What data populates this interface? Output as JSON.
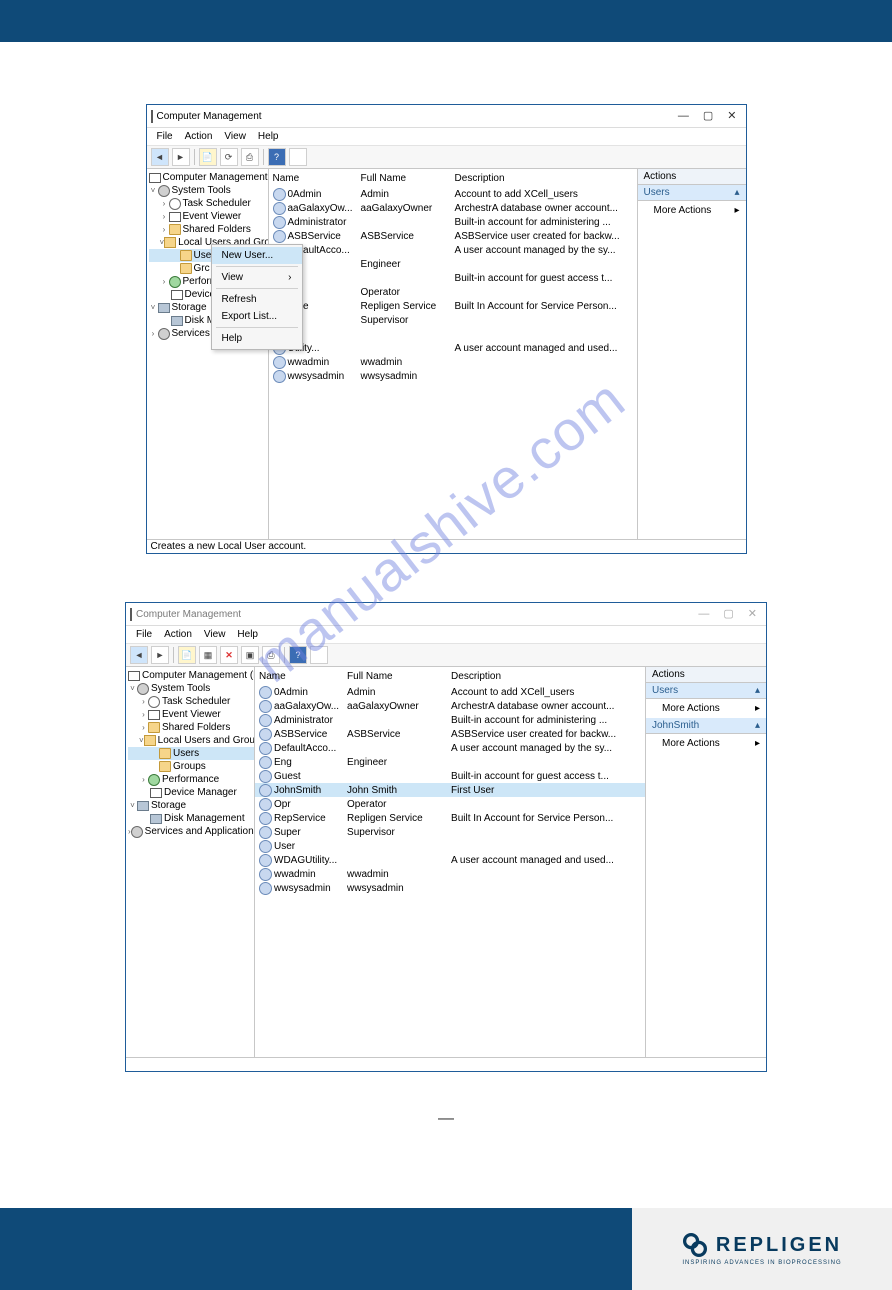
{
  "watermark": "manualshive.com",
  "brand": {
    "name": "REPLIGEN",
    "tagline": "INSPIRING ADVANCES IN BIOPROCESSING"
  },
  "win": {
    "title": "Computer Management",
    "menus": [
      "File",
      "Action",
      "View",
      "Help"
    ],
    "status1": "Creates a new Local User account.",
    "actionsHeader": "Actions",
    "actionsUsers": "Users",
    "moreActions": "More Actions",
    "johnSmith": "JohnSmith"
  },
  "tree1": {
    "root": "Computer Management (Local)",
    "systemTools": "System Tools",
    "taskScheduler": "Task Scheduler",
    "eventViewer": "Event Viewer",
    "sharedFolders": "Shared Folders",
    "lug": "Local Users and Groups",
    "users": "Users",
    "groups": "Groups",
    "grcShort": "Grc",
    "performance": "Perform",
    "deviceMgr": "Device",
    "storage": "Storage",
    "diskMgmt": "Disk M",
    "servicesApps": "Services ar"
  },
  "tree2": {
    "root": "Computer Management (Local)",
    "systemTools": "System Tools",
    "taskScheduler": "Task Scheduler",
    "eventViewer": "Event Viewer",
    "sharedFolders": "Shared Folders",
    "lug": "Local Users and Groups",
    "users": "Users",
    "groups": "Groups",
    "performance": "Performance",
    "deviceMgr": "Device Manager",
    "storage": "Storage",
    "diskMgmt": "Disk Management",
    "servicesApps": "Services and Applications"
  },
  "cols": {
    "name": "Name",
    "full": "Full Name",
    "desc": "Description"
  },
  "ctx": {
    "newUser": "New User...",
    "view": "View",
    "refresh": "Refresh",
    "export": "Export List...",
    "help": "Help"
  },
  "users1": [
    {
      "n": "0Admin",
      "f": "Admin",
      "d": "Account to add XCell_users"
    },
    {
      "n": "aaGalaxyOw...",
      "f": "aaGalaxyOwner",
      "d": "ArchestrA database owner account..."
    },
    {
      "n": "Administrator",
      "f": "",
      "d": "Built-in account for administering ..."
    },
    {
      "n": "ASBService",
      "f": "ASBService",
      "d": "ASBService user created for backw..."
    },
    {
      "n": "DefaultAcco...",
      "f": "",
      "d": "A user account managed by the sy..."
    },
    {
      "n": "",
      "f": "Engineer",
      "d": ""
    },
    {
      "n": "",
      "f": "",
      "d": "Built-in account for guest access t..."
    },
    {
      "n": "",
      "f": "Operator",
      "d": ""
    },
    {
      "n": "rvice",
      "f": "Repligen Service",
      "d": "Built In Account for Service Person..."
    },
    {
      "n": "",
      "f": "Supervisor",
      "d": ""
    },
    {
      "n": "",
      "f": "",
      "d": ""
    },
    {
      "n": "Utility...",
      "f": "",
      "d": "A user account managed and used..."
    },
    {
      "n": "wwadmin",
      "f": "wwadmin",
      "d": ""
    },
    {
      "n": "wwsysadmin",
      "f": "wwsysadmin",
      "d": ""
    }
  ],
  "users2": [
    {
      "n": "0Admin",
      "f": "Admin",
      "d": "Account to add XCell_users"
    },
    {
      "n": "aaGalaxyOw...",
      "f": "aaGalaxyOwner",
      "d": "ArchestrA database owner account..."
    },
    {
      "n": "Administrator",
      "f": "",
      "d": "Built-in account for administering ..."
    },
    {
      "n": "ASBService",
      "f": "ASBService",
      "d": "ASBService user created for backw..."
    },
    {
      "n": "DefaultAcco...",
      "f": "",
      "d": "A user account managed by the sy..."
    },
    {
      "n": "Eng",
      "f": "Engineer",
      "d": ""
    },
    {
      "n": "Guest",
      "f": "",
      "d": "Built-in account for guest access t..."
    },
    {
      "n": "JohnSmith",
      "f": "John Smith",
      "d": "First User",
      "hl": true
    },
    {
      "n": "Opr",
      "f": "Operator",
      "d": ""
    },
    {
      "n": "RepService",
      "f": "Repligen Service",
      "d": "Built In Account for Service Person..."
    },
    {
      "n": "Super",
      "f": "Supervisor",
      "d": ""
    },
    {
      "n": "User",
      "f": "",
      "d": ""
    },
    {
      "n": "WDAGUtility...",
      "f": "",
      "d": "A user account managed and used..."
    },
    {
      "n": "wwadmin",
      "f": "wwadmin",
      "d": ""
    },
    {
      "n": "wwsysadmin",
      "f": "wwsysadmin",
      "d": ""
    }
  ]
}
